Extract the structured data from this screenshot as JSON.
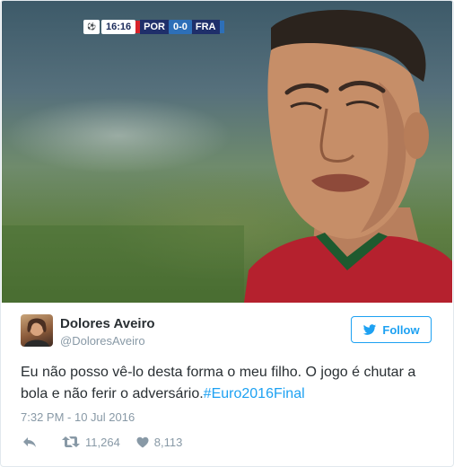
{
  "media": {
    "scorebug": {
      "time": "16:16",
      "team_home": "POR",
      "score": "0-0",
      "team_away": "FRA"
    }
  },
  "tweet": {
    "author_name": "Dolores Aveiro",
    "author_handle": "@DoloresAveiro",
    "follow_label": "Follow",
    "text_main": "Eu não posso vê-lo desta forma o meu filho. O jogo é chutar a bola e não ferir o adversário.",
    "hashtag": "#Euro2016Final",
    "timestamp": "7:32 PM - 10 Jul 2016",
    "retweets": "11,264",
    "likes": "8,113"
  },
  "colors": {
    "accent": "#1da1f2",
    "muted": "#8899a6",
    "text": "#292f33"
  },
  "icons": [
    "reply-icon",
    "retweet-icon",
    "like-icon",
    "twitter-bird-icon"
  ]
}
